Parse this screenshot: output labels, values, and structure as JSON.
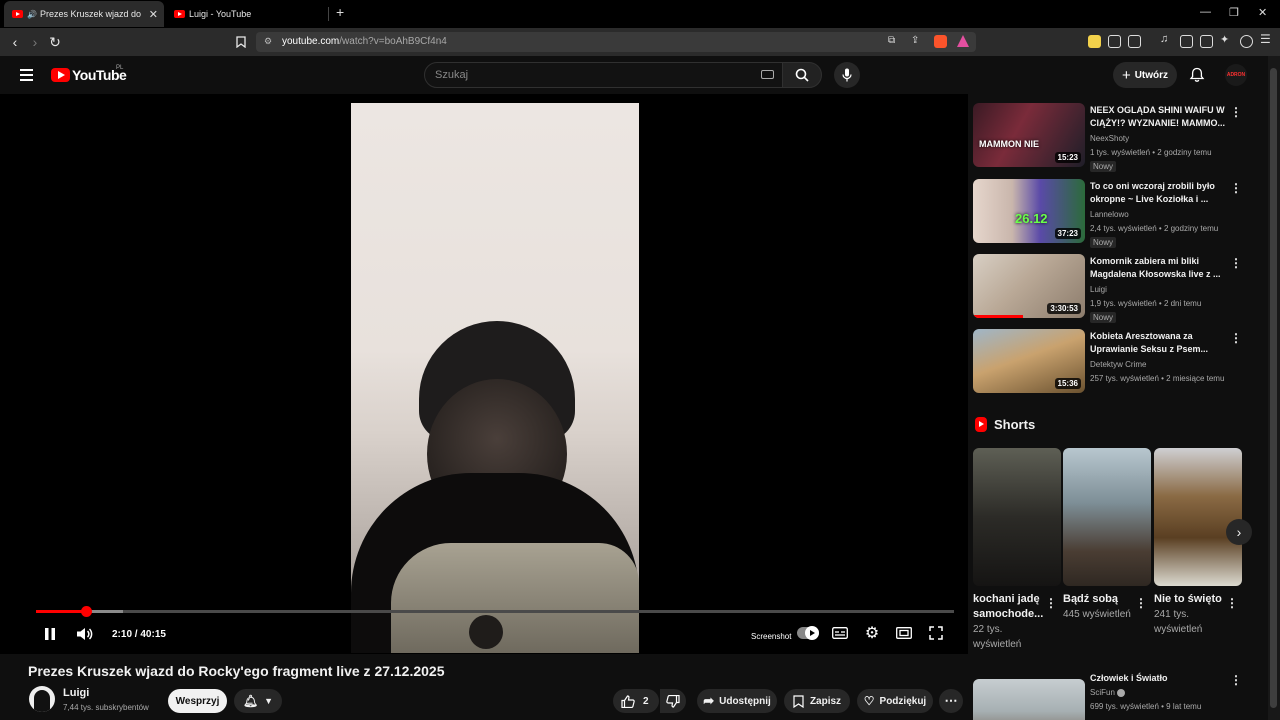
{
  "browser": {
    "tabs": [
      {
        "label": "Prezes Kruszek wjazd do Rock"
      },
      {
        "label": "Luigi - YouTube"
      }
    ],
    "url_host": "youtube.com",
    "url_path": "/watch?v=boAhB9Cf4n4"
  },
  "header": {
    "logo_text": "YouTube",
    "country_code": "PL",
    "search_placeholder": "Szukaj",
    "create_label": "Utwórz",
    "avatar_text": "ADRON"
  },
  "player": {
    "time_current": "2:10",
    "time_separator": "/",
    "time_total": "40:15",
    "progress": 0.054,
    "buffered": 0.095,
    "screenshot_label": "Screenshot"
  },
  "video": {
    "title": "Prezes Kruszek wjazd do Rocky'ego fragment live z 27.12.2025",
    "channel": "Luigi",
    "subscribers": "7,44 tys. subskrybentów",
    "support_label": "Wesprzyj",
    "likes": "2",
    "share_label": "Udostępnij",
    "save_label": "Zapisz",
    "thanks_label": "Podziękuj"
  },
  "recommendations": [
    {
      "title": "NEEX OGLĄDA SHINI WAIFU W CIĄŻY!? WYZNANIE! MAMMO...",
      "channel": "NeexShoty",
      "meta": "1 tys. wyświetleń • 2 godziny temu",
      "badge": "Nowy",
      "duration": "15:23"
    },
    {
      "title": "To co oni wczoraj zrobili było okropne ~ Live Koziołka i ...",
      "channel": "Lannelowo",
      "meta": "2,4 tys. wyświetleń • 2 godziny temu",
      "badge": "Nowy",
      "duration": "37:23"
    },
    {
      "title": "Komornik zabiera mi bliki Magdalena Kłosowska live z ...",
      "channel": "Luigi",
      "meta": "1,9 tys. wyświetleń • 2 dni temu",
      "badge": "Nowy",
      "duration": "3:30:53"
    },
    {
      "title": "Kobieta Aresztowana za Uprawianie Seksu z Psem...",
      "channel": "Detektyw Crime",
      "meta": "257 tys. wyświetleń • 2 miesiące temu",
      "badge": "",
      "duration": "15:36"
    }
  ],
  "shorts": {
    "heading": "Shorts",
    "items": [
      {
        "title": "kochani jadę samochode...",
        "views": "22 tys. wyświetleń"
      },
      {
        "title": "Bądź sobą",
        "views": "445 wyświetleń"
      },
      {
        "title": "Nie to święto",
        "views": "241 tys. wyświetleń"
      }
    ]
  },
  "bottom_rec": {
    "title": "Człowiek i Światło",
    "channel": "SciFun",
    "meta": "699 tys. wyświetleń • 9 lat temu"
  },
  "thumb_overlays": {
    "t1_text": "MAMMON NIE",
    "t2_text": "26.12"
  },
  "colors": {
    "brand_red": "#ff0000",
    "background": "#0f0f0f",
    "pill": "#272727"
  }
}
